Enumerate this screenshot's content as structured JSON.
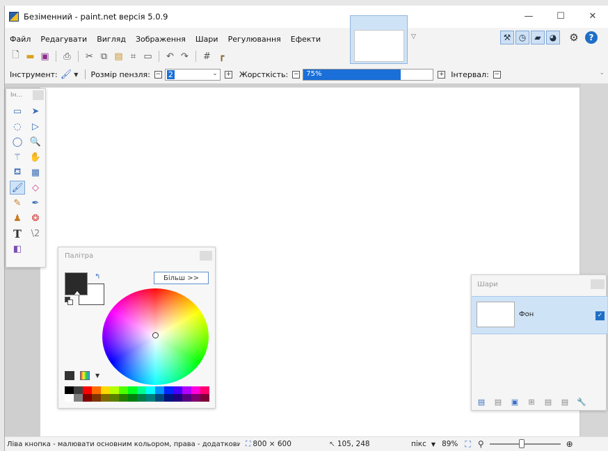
{
  "window": {
    "title": "Безіменний - paint.net версія 5.0.9",
    "minimize": "—",
    "maximize": "☐",
    "close": "✕"
  },
  "menu": [
    "Файл",
    "Редагувати",
    "Вигляд",
    "Зображення",
    "Шари",
    "Регулювання",
    "Ефекти"
  ],
  "toolbar_icons": [
    "new-icon",
    "open-icon",
    "save-icon",
    "print-icon",
    "cut-icon",
    "copy-icon",
    "paste-icon",
    "crop-icon",
    "deselect-icon",
    "undo-icon",
    "redo-icon",
    "grid-icon",
    "ruler-icon"
  ],
  "options": {
    "tool_label": "Інструмент:",
    "brush_size_label": "Розмір пензля:",
    "brush_size_value": "2",
    "hardness_label": "Жорсткість:",
    "hardness_value": "75%",
    "hardness_fraction": 0.75,
    "interval_label": "Інтервал:"
  },
  "tools_panel": {
    "title": "Ін..."
  },
  "palette": {
    "title": "Палітра",
    "more_button": "Більш >>",
    "primary_color": "#2a2a2a",
    "secondary_color": "#ffffff",
    "swatches": [
      "#000000",
      "#404040",
      "#ff0000",
      "#ff6a00",
      "#ffd800",
      "#b6ff00",
      "#4cff00",
      "#00ff21",
      "#00ff90",
      "#00ffff",
      "#0094ff",
      "#0026ff",
      "#4800ff",
      "#b200ff",
      "#ff00dc",
      "#ff006e",
      "#ffffff",
      "#808080",
      "#7f0000",
      "#7f3300",
      "#7f6a00",
      "#5b7f00",
      "#267f00",
      "#007f0e",
      "#007f46",
      "#007f7f",
      "#004a7f",
      "#00137f",
      "#21007f",
      "#57007f",
      "#7f006e",
      "#7f0037"
    ]
  },
  "layers": {
    "title": "Шари",
    "layer_name": "Фон",
    "visible_check": "✓"
  },
  "status": {
    "hint": "Ліва кнопка - малювати основним кольором, права - додатковим.",
    "image_size": "800 × 600",
    "cursor_pos": "105, 248",
    "unit": "пікс",
    "zoom": "89%",
    "zoom_fraction": 0.45
  }
}
